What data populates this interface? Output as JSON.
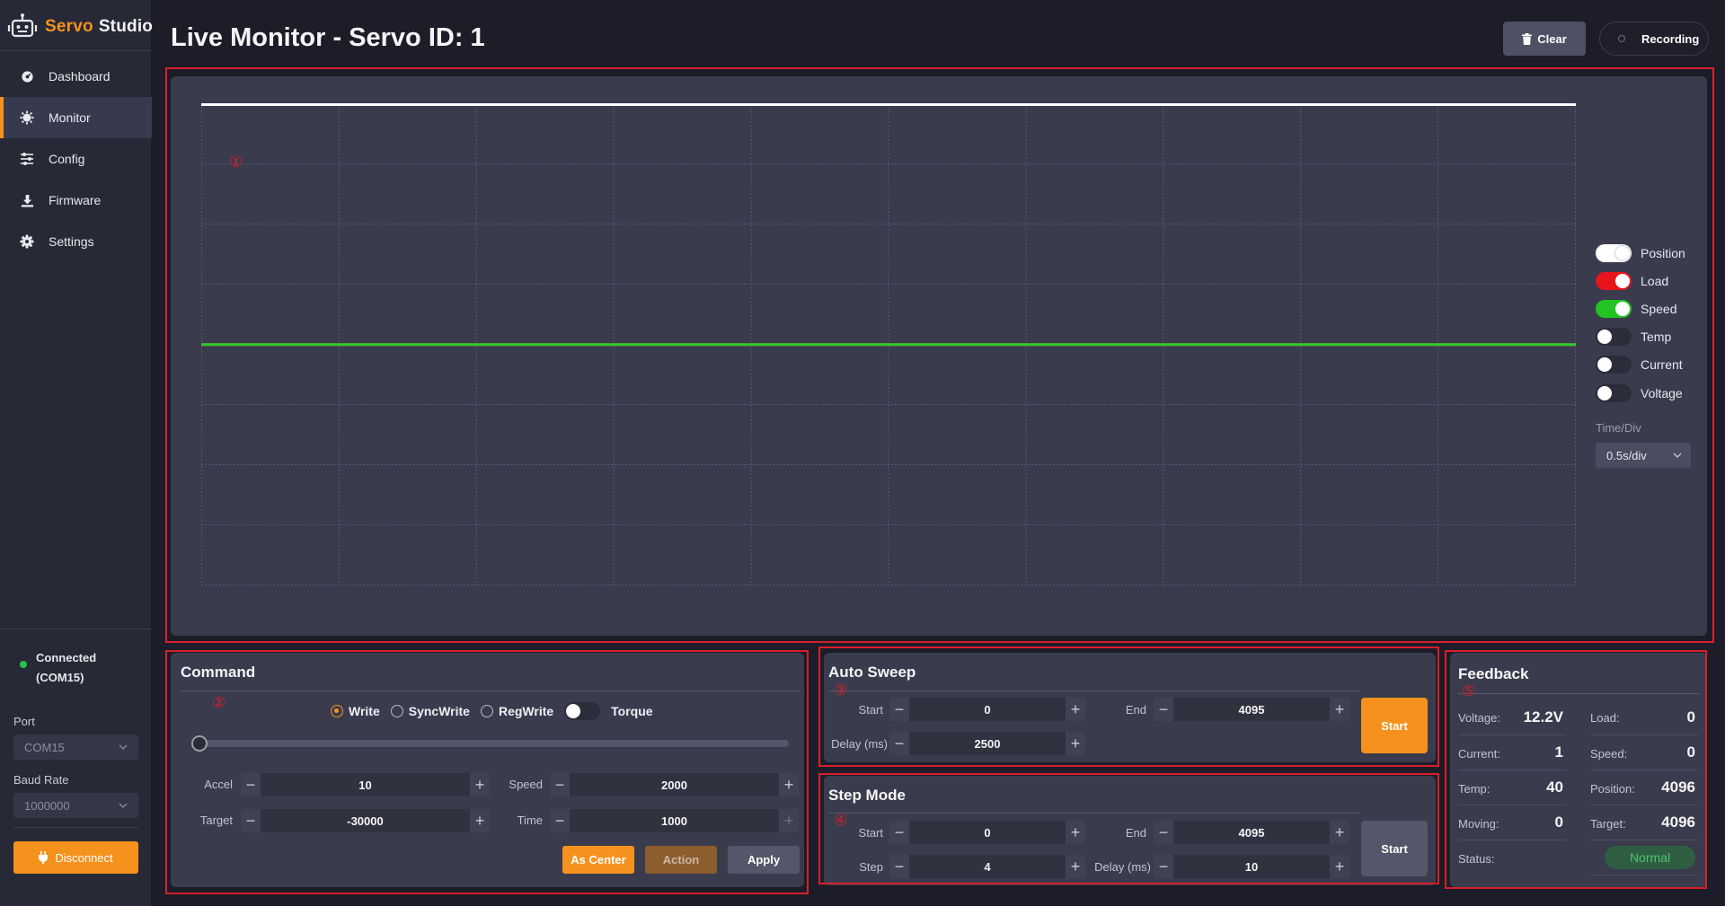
{
  "app": {
    "brand_part1": "Servo",
    "brand_part2": "Studio",
    "accent_color": "#f5921e"
  },
  "sidebar": {
    "items": [
      {
        "label": "Dashboard",
        "icon": "dashboard-icon",
        "active": false
      },
      {
        "label": "Monitor",
        "icon": "monitor-icon",
        "active": true
      },
      {
        "label": "Config",
        "icon": "sliders-icon",
        "active": false
      },
      {
        "label": "Firmware",
        "icon": "download-icon",
        "active": false
      },
      {
        "label": "Settings",
        "icon": "gear-icon",
        "active": false
      }
    ],
    "connection": {
      "status_line1": "Connected",
      "status_line2": "(COM15)",
      "status_color": "#27c34b"
    },
    "port_label": "Port",
    "port_value": "COM15",
    "baud_label": "Baud Rate",
    "baud_value": "1000000",
    "disconnect_label": "Disconnect"
  },
  "header": {
    "title": "Live Monitor - Servo ID: 1",
    "clear_label": "Clear",
    "recording_label": "Recording"
  },
  "annotations": {
    "m1": "①",
    "m2": "②",
    "m3": "③",
    "m4": "④",
    "m5": "⑤"
  },
  "chart_data": {
    "type": "line",
    "grid": true,
    "grid_columns": 10,
    "grid_rows": 8,
    "series": [
      {
        "name": "Position",
        "color": "#ffffff",
        "visible": true,
        "level": 1.0
      },
      {
        "name": "Load",
        "color": "#ff1a1a",
        "visible": true,
        "level": 0.5
      },
      {
        "name": "Speed",
        "color": "#2ecc2e",
        "visible": true,
        "level": 0.5
      },
      {
        "name": "Temp",
        "visible": false
      },
      {
        "name": "Current",
        "visible": false
      },
      {
        "name": "Voltage",
        "visible": false
      }
    ],
    "time_div_label": "Time/Div",
    "time_div_value": "0.5s/div"
  },
  "legend": [
    {
      "label": "Position",
      "on": true,
      "track_color": "#ffffff",
      "knob_color": "#ffffff"
    },
    {
      "label": "Load",
      "on": true,
      "track_color": "#e8141c",
      "knob_color": "#ffffff"
    },
    {
      "label": "Speed",
      "on": true,
      "track_color": "#22c322",
      "knob_color": "#ffffff"
    },
    {
      "label": "Temp",
      "on": false
    },
    {
      "label": "Current",
      "on": false
    },
    {
      "label": "Voltage",
      "on": false
    }
  ],
  "command": {
    "title": "Command",
    "modes": [
      {
        "label": "Write",
        "checked": true
      },
      {
        "label": "SyncWrite",
        "checked": false
      },
      {
        "label": "RegWrite",
        "checked": false
      }
    ],
    "torque_label": "Torque",
    "torque_on": false,
    "slider_value": 0,
    "fields": {
      "accel": {
        "label": "Accel",
        "value": "10"
      },
      "speed": {
        "label": "Speed",
        "value": "2000"
      },
      "target": {
        "label": "Target",
        "value": "-30000"
      },
      "time": {
        "label": "Time",
        "value": "1000"
      }
    },
    "as_center_label": "As Center",
    "action_label": "Action",
    "apply_label": "Apply"
  },
  "auto_sweep": {
    "title": "Auto Sweep",
    "start_label": "Start",
    "start_value": "0",
    "end_label": "End",
    "end_value": "4095",
    "delay_label": "Delay (ms)",
    "delay_value": "2500",
    "button_label": "Start"
  },
  "step_mode": {
    "title": "Step Mode",
    "start_label": "Start",
    "start_value": "0",
    "end_label": "End",
    "end_value": "4095",
    "step_label": "Step",
    "step_value": "4",
    "delay_label": "Delay (ms)",
    "delay_value": "10",
    "button_label": "Start"
  },
  "feedback": {
    "title": "Feedback",
    "voltage": {
      "label": "Voltage:",
      "value": "12.2V"
    },
    "load": {
      "label": "Load:",
      "value": "0"
    },
    "current": {
      "label": "Current:",
      "value": "1"
    },
    "speed": {
      "label": "Speed:",
      "value": "0"
    },
    "temp": {
      "label": "Temp:",
      "value": "40"
    },
    "position": {
      "label": "Position:",
      "value": "4096"
    },
    "moving": {
      "label": "Moving:",
      "value": "0"
    },
    "target": {
      "label": "Target:",
      "value": "4096"
    },
    "status": {
      "label": "Status:",
      "value": "Normal"
    }
  }
}
